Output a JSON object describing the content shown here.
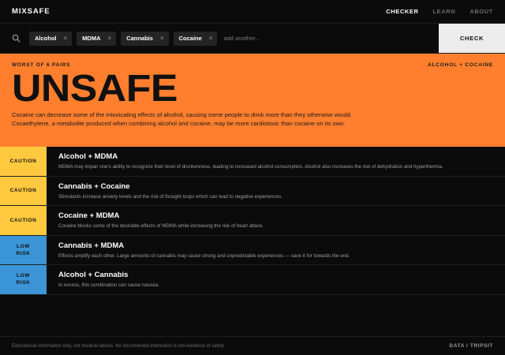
{
  "header": {
    "logo": "MIXSAFE",
    "nav": [
      {
        "label": "CHECKER",
        "active": true
      },
      {
        "label": "LEARN",
        "active": false
      },
      {
        "label": "ABOUT",
        "active": false
      }
    ]
  },
  "search": {
    "icon": "search-icon",
    "chips": [
      {
        "label": "Alcohol"
      },
      {
        "label": "MDMA"
      },
      {
        "label": "Cannabis"
      },
      {
        "label": "Cocaine"
      }
    ],
    "remove_glyph": "×",
    "placeholder": "add another...",
    "value": "",
    "check_label": "CHECK"
  },
  "verdict": {
    "eyebrow": "WORST OF 6 PAIRS",
    "pair": "ALCOHOL + COCAINE",
    "word": "UNSAFE",
    "description": "Cocaine can decrease some of the intoxicating effects of alcohol, causing some people to drink more than they otherwise would. Cocaethylene, a metabolite produced when combining alcohol and cocaine, may be more cardiotoxic than cocaine on its own.",
    "color": "#ff7f2e"
  },
  "interactions": [
    {
      "badge": "CAUTION",
      "level": "caution",
      "title": "Alcohol + MDMA",
      "desc": "MDMA may impair one's ability to recognize their level of drunkenness, leading to increased alcohol consumption. Alcohol also increases the risk of dehydration and hyperthermia."
    },
    {
      "badge": "CAUTION",
      "level": "caution",
      "title": "Cannabis + Cocaine",
      "desc": "Stimulants increase anxiety levels and the risk of thought loops which can lead to negative experiences."
    },
    {
      "badge": "CAUTION",
      "level": "caution",
      "title": "Cocaine + MDMA",
      "desc": "Cocaine blocks some of the desirable effects of MDMA while increasing the risk of heart attack."
    },
    {
      "badge": "LOW\nRISK",
      "level": "lowrisk",
      "title": "Cannabis + MDMA",
      "desc": "Effects amplify each other. Large amounts of cannabis may cause strong and unpredictable experiences — save it for towards the end."
    },
    {
      "badge": "LOW\nRISK",
      "level": "lowrisk",
      "title": "Alcohol + Cannabis",
      "desc": "In excess, this combination can cause nausea."
    }
  ],
  "colors": {
    "caution": "#ffc93f",
    "low_risk": "#3b95d6",
    "background": "#0b0b0b"
  },
  "footer": {
    "note": "Educational information only, not medical advice. No documented interaction is not evidence of safety.",
    "link": "DATA / TRIPSIT"
  }
}
